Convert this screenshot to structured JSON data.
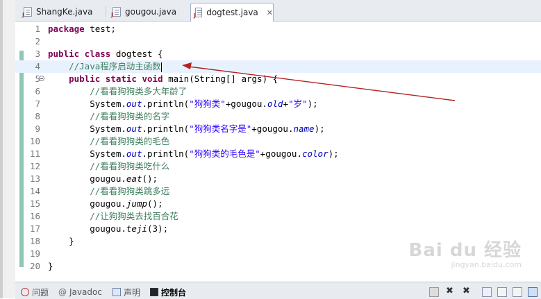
{
  "tabs": [
    {
      "label": "ShangKe.java",
      "active": false
    },
    {
      "label": "gougou.java",
      "active": false
    },
    {
      "label": "dogtest.java",
      "active": true,
      "close": "✕"
    }
  ],
  "code_lines": [
    {
      "n": "1",
      "parts": [
        {
          "t": "kw",
          "v": "package"
        },
        {
          "t": "",
          "v": " test;"
        }
      ]
    },
    {
      "n": "2",
      "parts": []
    },
    {
      "n": "3",
      "parts": [
        {
          "t": "kw",
          "v": "public class"
        },
        {
          "t": "",
          "v": " dogtest {"
        }
      ]
    },
    {
      "n": "4",
      "parts": [
        {
          "t": "cm",
          "v": "    //Java程序启动主函数"
        }
      ],
      "current": true
    },
    {
      "n": "5",
      "parts": [
        {
          "t": "",
          "v": "    "
        },
        {
          "t": "kw",
          "v": "public static void"
        },
        {
          "t": "",
          "v": " main(String[] args) {"
        }
      ],
      "fold": true
    },
    {
      "n": "6",
      "parts": [
        {
          "t": "cm",
          "v": "        //看看狗狗类多大年龄了"
        }
      ]
    },
    {
      "n": "7",
      "parts": [
        {
          "t": "",
          "v": "        System."
        },
        {
          "t": "fd",
          "v": "out"
        },
        {
          "t": "",
          "v": ".println("
        },
        {
          "t": "st",
          "v": "\"狗狗类\""
        },
        {
          "t": "",
          "v": "+gougou."
        },
        {
          "t": "fd",
          "v": "old"
        },
        {
          "t": "",
          "v": "+"
        },
        {
          "t": "st",
          "v": "\"岁\""
        },
        {
          "t": "",
          "v": ");"
        }
      ]
    },
    {
      "n": "8",
      "parts": [
        {
          "t": "cm",
          "v": "        //看看狗狗类的名字"
        }
      ]
    },
    {
      "n": "9",
      "parts": [
        {
          "t": "",
          "v": "        System."
        },
        {
          "t": "fd",
          "v": "out"
        },
        {
          "t": "",
          "v": ".println("
        },
        {
          "t": "st",
          "v": "\"狗狗类名字是\""
        },
        {
          "t": "",
          "v": "+gougou."
        },
        {
          "t": "fd",
          "v": "name"
        },
        {
          "t": "",
          "v": ");"
        }
      ]
    },
    {
      "n": "10",
      "parts": [
        {
          "t": "cm",
          "v": "        //看看狗狗类的毛色"
        }
      ]
    },
    {
      "n": "11",
      "parts": [
        {
          "t": "",
          "v": "        System."
        },
        {
          "t": "fd",
          "v": "out"
        },
        {
          "t": "",
          "v": ".println("
        },
        {
          "t": "st",
          "v": "\"狗狗类的毛色是\""
        },
        {
          "t": "",
          "v": "+gougou."
        },
        {
          "t": "fd",
          "v": "color"
        },
        {
          "t": "",
          "v": ");"
        }
      ]
    },
    {
      "n": "12",
      "parts": [
        {
          "t": "cm",
          "v": "        //看看狗狗类吃什么"
        }
      ]
    },
    {
      "n": "13",
      "parts": [
        {
          "t": "",
          "v": "        gougou."
        },
        {
          "t": "mi",
          "v": "eat"
        },
        {
          "t": "",
          "v": "();"
        }
      ]
    },
    {
      "n": "14",
      "parts": [
        {
          "t": "cm",
          "v": "        //看看狗狗类跳多远"
        }
      ]
    },
    {
      "n": "15",
      "parts": [
        {
          "t": "",
          "v": "        gougou."
        },
        {
          "t": "mi",
          "v": "jump"
        },
        {
          "t": "",
          "v": "();"
        }
      ]
    },
    {
      "n": "16",
      "parts": [
        {
          "t": "cm",
          "v": "        //让狗狗类去找百合花"
        }
      ]
    },
    {
      "n": "17",
      "parts": [
        {
          "t": "",
          "v": "        gougou."
        },
        {
          "t": "mi",
          "v": "teji"
        },
        {
          "t": "",
          "v": "(3);"
        }
      ]
    },
    {
      "n": "18",
      "parts": [
        {
          "t": "",
          "v": "    }"
        }
      ]
    },
    {
      "n": "19",
      "parts": []
    },
    {
      "n": "20",
      "parts": [
        {
          "t": "",
          "v": "}"
        }
      ]
    }
  ],
  "bottom_tabs": [
    {
      "label": "问题",
      "icon": "problems-icon",
      "active": false
    },
    {
      "label": "Javadoc",
      "icon": "javadoc-icon",
      "active": false
    },
    {
      "label": "声明",
      "icon": "declaration-icon",
      "active": false
    },
    {
      "label": "控制台",
      "icon": "console-icon",
      "active": true
    }
  ],
  "watermark": {
    "line1": "Bai du 经验",
    "line2": "jingyan.baidu.com"
  },
  "colors": {
    "keyword": "#7f0055",
    "comment": "#3f7f5f",
    "string": "#2a00ff",
    "field": "#0000c0",
    "annotation_arrow": "#b22222"
  }
}
